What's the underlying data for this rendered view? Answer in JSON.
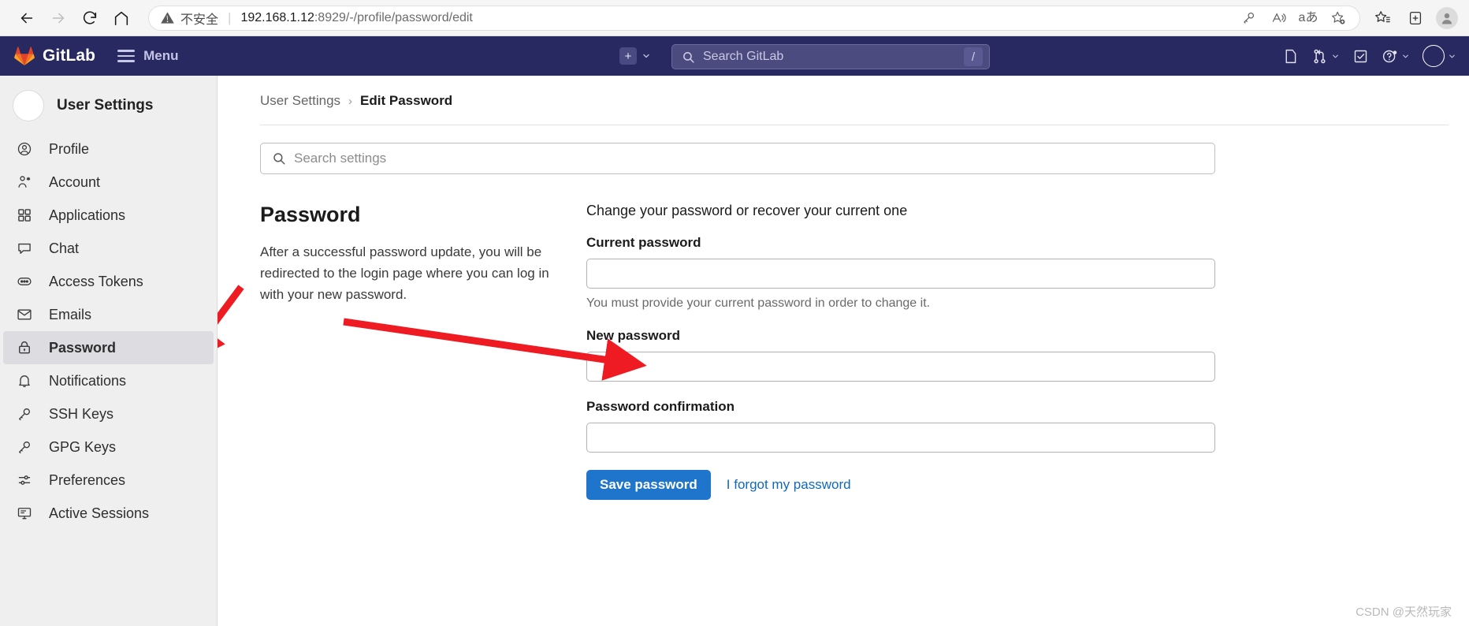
{
  "browser": {
    "back_label": "Back",
    "forward_label": "Forward",
    "reload_label": "Refresh",
    "home_label": "Home",
    "security_warning": "不安全",
    "url_host": "192.168.1.12",
    "url_rest": ":8929/-/profile/password/edit",
    "url_full": "192.168.1.12:8929/-/profile/password/edit",
    "icons": {
      "warning": "warning-triangle-icon",
      "key": "key-icon",
      "read_aloud": "read-aloud-icon",
      "translate": "translate-icon",
      "add_favorite": "add-favorite-icon",
      "favorites": "favorites-list-icon",
      "collections": "collections-icon",
      "profile": "browser-profile-icon"
    }
  },
  "navbar": {
    "brand": "GitLab",
    "menu_label": "Menu",
    "create_label": "+",
    "search_placeholder": "Search GitLab",
    "search_shortcut": "/",
    "icons": {
      "logo": "gitlab-logo-icon",
      "hamburger": "hamburger-icon",
      "plus": "plus-square-icon",
      "search": "search-icon",
      "issues": "issues-icon",
      "merge_requests": "merge-requests-icon",
      "todos": "todos-icon",
      "help": "help-icon",
      "avatar": "user-avatar-icon"
    }
  },
  "sidebar": {
    "header": "User Settings",
    "items": [
      {
        "label": "Profile",
        "icon": "profile-icon",
        "active": false
      },
      {
        "label": "Account",
        "icon": "account-icon",
        "active": false
      },
      {
        "label": "Applications",
        "icon": "applications-icon",
        "active": false
      },
      {
        "label": "Chat",
        "icon": "chat-icon",
        "active": false
      },
      {
        "label": "Access Tokens",
        "icon": "access-tokens-icon",
        "active": false
      },
      {
        "label": "Emails",
        "icon": "emails-icon",
        "active": false
      },
      {
        "label": "Password",
        "icon": "lock-icon",
        "active": true
      },
      {
        "label": "Notifications",
        "icon": "bell-icon",
        "active": false
      },
      {
        "label": "SSH Keys",
        "icon": "key-icon",
        "active": false
      },
      {
        "label": "GPG Keys",
        "icon": "key-icon",
        "active": false
      },
      {
        "label": "Preferences",
        "icon": "preferences-icon",
        "active": false
      },
      {
        "label": "Active Sessions",
        "icon": "active-sessions-icon",
        "active": false
      }
    ]
  },
  "breadcrumb": {
    "parent": "User Settings",
    "separator": "›",
    "current": "Edit Password"
  },
  "settings_search": {
    "placeholder": "Search settings",
    "value": ""
  },
  "section": {
    "title": "Password",
    "description": "After a successful password update, you will be redirected to the login page where you can log in with your new password."
  },
  "form": {
    "intro": "Change your password or recover your current one",
    "fields": [
      {
        "label": "Current password",
        "value": "",
        "help": "You must provide your current password in order to change it."
      },
      {
        "label": "New password",
        "value": "",
        "help": ""
      },
      {
        "label": "Password confirmation",
        "value": "",
        "help": ""
      }
    ],
    "submit_label": "Save password",
    "forgot_link_label": "I forgot my password"
  },
  "watermark": "CSDN @天然玩家",
  "colors": {
    "navbar_bg": "#292961",
    "sidebar_bg": "#efefef",
    "active_item_bg": "#dcdce1",
    "primary_button": "#1f75cb",
    "link": "#1068bf",
    "annotation_arrow": "#ee1b22"
  }
}
